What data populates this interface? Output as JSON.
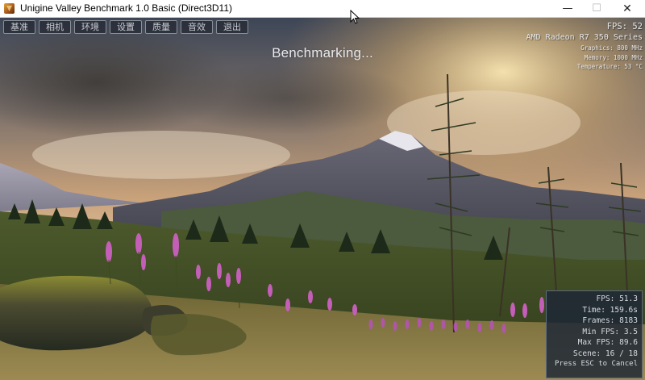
{
  "window": {
    "title": "Unigine Valley Benchmark 1.0 Basic (Direct3D11)",
    "controls": {
      "minimize": "—",
      "maximize": "☐",
      "close": "✕"
    }
  },
  "menu": [
    "基准",
    "相机",
    "环境",
    "设置",
    "质量",
    "音效",
    "退出"
  ],
  "status": "Benchmarking...",
  "hud": {
    "fps": "FPS: 52",
    "gpu": "AMD Radeon R7 350 Series",
    "graphics": "Graphics: 800 MHz",
    "memory": "Memory: 1000 MHz",
    "temperature": "Temperature: 53 °C"
  },
  "stats": {
    "fps": "FPS: 51.3",
    "time": "Time: 159.6s",
    "frames": "Frames: 8183",
    "min_fps": "Min FPS: 3.5",
    "max_fps": "Max FPS: 89.6",
    "scene": "Scene: 16 / 18",
    "hint": "Press ESC to Cancel"
  }
}
